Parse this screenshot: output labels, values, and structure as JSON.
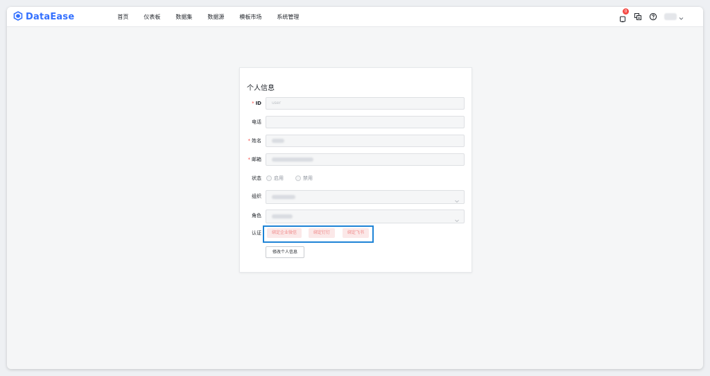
{
  "app": {
    "brand": "DataEase"
  },
  "nav": {
    "items": [
      "首页",
      "仪表板",
      "数据集",
      "数据源",
      "模板市场",
      "系统管理"
    ]
  },
  "header": {
    "notification_count": "0"
  },
  "form": {
    "title": "个人信息",
    "fields": {
      "id": {
        "label": "ID",
        "value": "user"
      },
      "phone": {
        "label": "电话"
      },
      "name": {
        "label": "姓名"
      },
      "email": {
        "label": "邮箱"
      },
      "status": {
        "label": "状态",
        "options": [
          "启用",
          "禁用"
        ],
        "selected": "启用"
      },
      "org": {
        "label": "组织"
      },
      "role": {
        "label": "角色"
      },
      "auth": {
        "label": "认证",
        "buttons": [
          "绑定企业微信",
          "绑定钉钉",
          "绑定飞书"
        ]
      }
    },
    "submit_label": "修改个人信息"
  },
  "colors": {
    "brand": "#3370ff",
    "highlight": "#1d83d6",
    "danger": "#f54a45"
  },
  "icons": [
    "dataease-logo-icon",
    "bell-icon",
    "translate-icon",
    "help-icon",
    "chevron-down-icon"
  ]
}
